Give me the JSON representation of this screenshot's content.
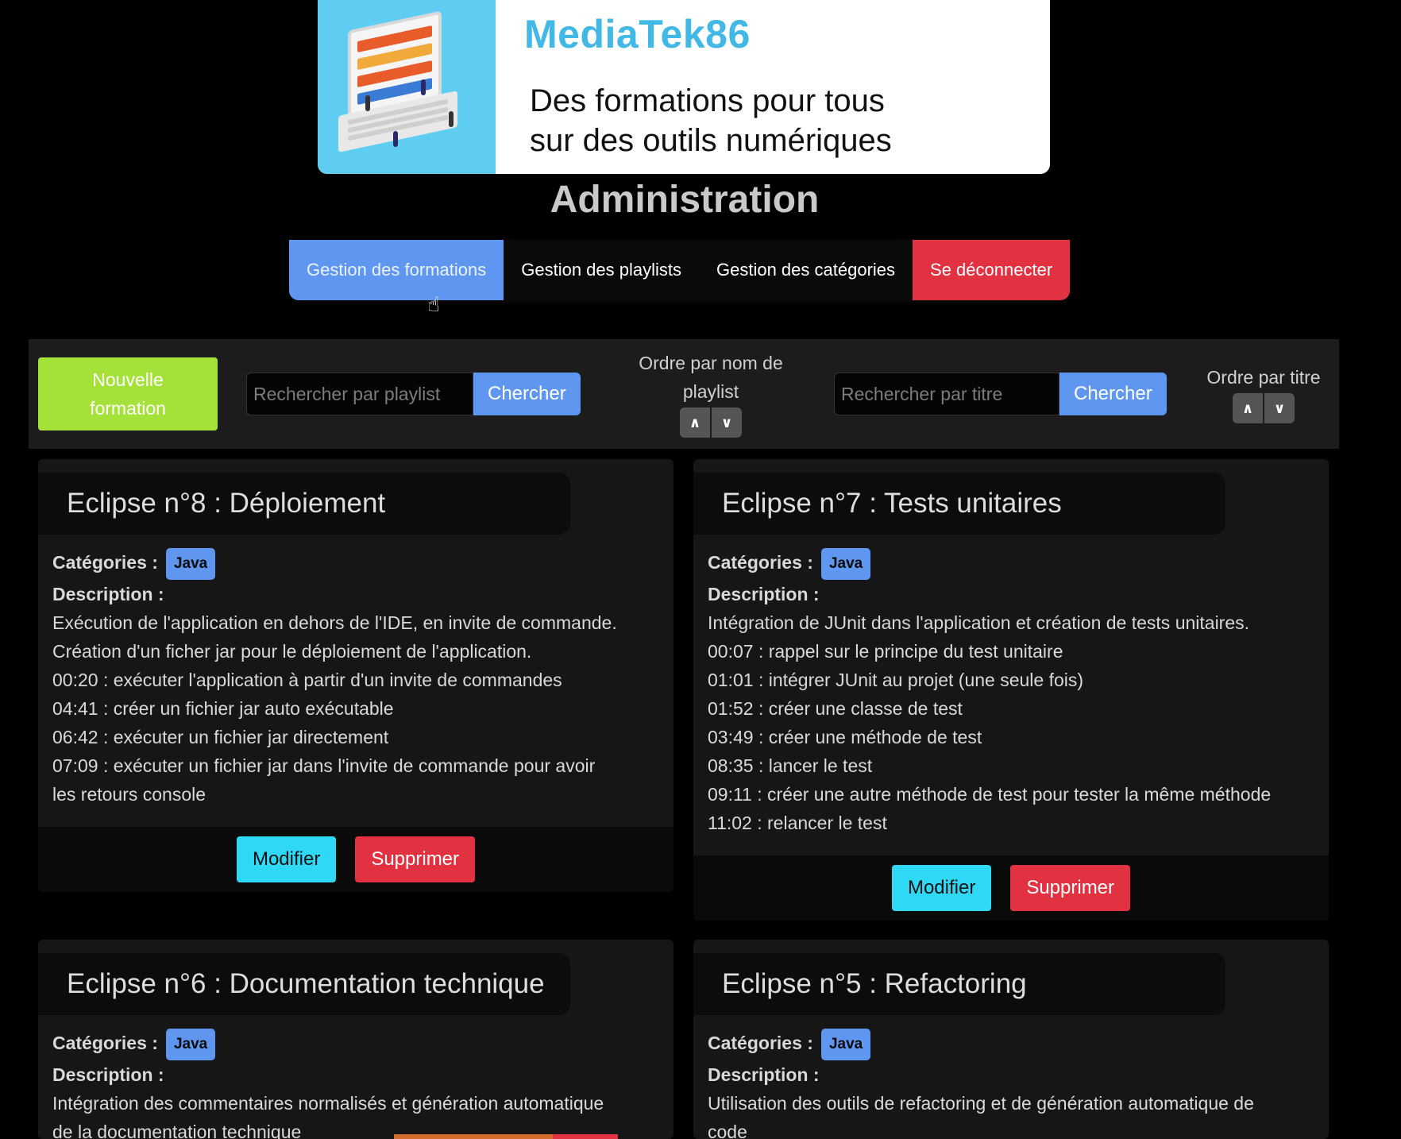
{
  "banner": {
    "brand": "MediaTek86",
    "tagline_line1": "Des formations pour tous",
    "tagline_line2": "sur des outils numériques"
  },
  "page_title": "Administration",
  "nav": {
    "items": [
      {
        "label": "Gestion des formations",
        "active": true
      },
      {
        "label": "Gestion des playlists"
      },
      {
        "label": "Gestion des catégories"
      },
      {
        "label": "Se déconnecter"
      }
    ]
  },
  "toolbar": {
    "new_button_line1": "Nouvelle",
    "new_button_line2": "formation",
    "playlist_search": {
      "placeholder": "Rechercher par playlist",
      "value": "",
      "button": "Chercher"
    },
    "playlist_order": {
      "line1": "Ordre par nom de",
      "line2": "playlist",
      "asc": "∧",
      "desc": "∨"
    },
    "title_search": {
      "placeholder": "Rechercher par titre",
      "value": "",
      "button": "Chercher"
    },
    "title_order": {
      "label": "Ordre par titre",
      "asc": "∧",
      "desc": "∨"
    }
  },
  "cards": [
    {
      "title": "Eclipse n°8 : Déploiement",
      "categories_label": "Catégories :",
      "category": "Java",
      "description_label": "Description :",
      "description": [
        "Exécution de l'application en dehors de l'IDE, en invite de commande.",
        "Création d'un ficher jar pour le déploiement de l'application.",
        "00:20 : exécuter l'application à partir d'un invite de commandes",
        "04:41 : créer un fichier jar auto exécutable",
        "06:42 : exécuter un fichier jar directement",
        "07:09 : exécuter un fichier jar dans l'invite de commande pour avoir",
        "les retours console"
      ],
      "modify": "Modifier",
      "delete": "Supprimer"
    },
    {
      "title": "Eclipse n°7 : Tests unitaires",
      "categories_label": "Catégories :",
      "category": "Java",
      "description_label": "Description :",
      "description": [
        "Intégration de JUnit dans l'application et création de tests unitaires.",
        "00:07 : rappel sur le principe du test unitaire",
        "01:01 : intégrer JUnit au projet (une seule fois)",
        "01:52 : créer une classe de test",
        "03:49 : créer une méthode de test",
        "08:35 : lancer le test",
        "09:11 : créer une autre méthode de test pour tester la même méthode",
        "11:02 : relancer le test"
      ],
      "modify": "Modifier",
      "delete": "Supprimer"
    },
    {
      "title": "Eclipse n°6 : Documentation technique",
      "categories_label": "Catégories :",
      "category": "Java",
      "description_label": "Description :",
      "description": [
        "Intégration des commentaires normalisés et génération automatique",
        "de la documentation technique"
      ]
    },
    {
      "title": "Eclipse n°5 : Refactoring",
      "categories_label": "Catégories :",
      "category": "Java",
      "description_label": "Description :",
      "description": [
        "Utilisation des outils de refactoring et de génération automatique de",
        "code"
      ]
    }
  ],
  "colors": {
    "primary": "#5f97f0",
    "danger": "#e23242",
    "success": "#a4e23a",
    "info": "#2fd8f5",
    "brand": "#41b8e6"
  }
}
